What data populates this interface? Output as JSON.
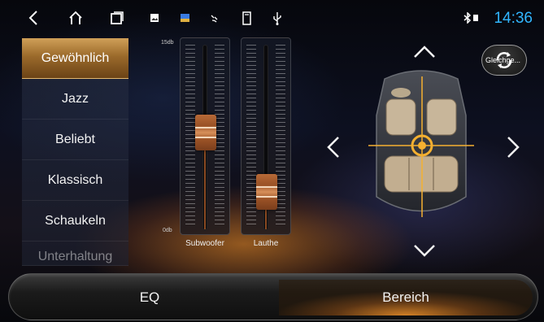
{
  "statusbar": {
    "icons": [
      "back-icon",
      "home-icon",
      "recent-apps-icon",
      "gallery-icon",
      "image-icon",
      "satellite-icon",
      "sd-card-icon",
      "usb-icon"
    ],
    "bluetooth_icon": "bluetooth-icon",
    "time": "14:36"
  },
  "presets": {
    "items": [
      "Gewöhnlich",
      "Jazz",
      "Beliebt",
      "Klassisch",
      "Schaukeln",
      "Unterhaltung"
    ],
    "selected": "Gewöhnlich"
  },
  "sliders": {
    "scale_top": "15db",
    "scale_bottom": "0db",
    "channels": [
      {
        "name": "Subwoofer",
        "level_db": 8
      },
      {
        "name": "Lauthe",
        "level_db": 2
      }
    ]
  },
  "sound_field": {
    "balance_button_label": "Gleichge...",
    "arrows": [
      "up",
      "down",
      "left",
      "right"
    ]
  },
  "tabs": {
    "eq_label": "EQ",
    "bereich_label": "Bereich",
    "active": "Bereich"
  },
  "colors": {
    "accent": "#d08a3a",
    "time_blue": "#31b6ff"
  }
}
